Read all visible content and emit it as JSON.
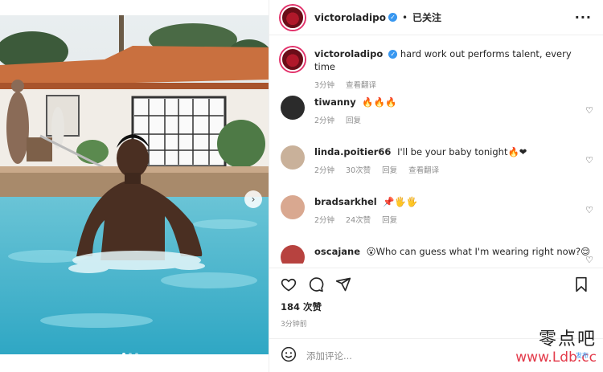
{
  "post": {
    "author": "victoroladipo",
    "follow_sep": "•",
    "follow_label": "已关注",
    "more_label": "···",
    "next_label": "›"
  },
  "caption": {
    "user": "victoroladipo",
    "text": "hard work out performs talent, every time",
    "time": "3分钟",
    "translate": "查看翻译"
  },
  "comments": [
    {
      "user": "tiwanny",
      "text": "🔥🔥🔥",
      "time": "2分钟",
      "likes": "",
      "reply": "回复",
      "translate": ""
    },
    {
      "user": "linda.poitier66",
      "text": "I'll be your baby tonight🔥❤",
      "time": "2分钟",
      "likes": "30次赞",
      "reply": "回复",
      "translate": "查看翻译"
    },
    {
      "user": "bradsarkhel",
      "text": "📌🖐🖐",
      "time": "2分钟",
      "likes": "24次赞",
      "reply": "回复",
      "translate": ""
    },
    {
      "user": "oscajane",
      "text": "😮Who can guess what I'm wearing right now?😌",
      "time": "",
      "likes": "",
      "reply": "",
      "translate": ""
    }
  ],
  "stats": {
    "likes": "184 次赞",
    "posted": "3分钟前"
  },
  "comment_input": {
    "placeholder": "添加评论..."
  },
  "watermark": {
    "cn": "零点吧",
    "en": "www.Ldb.cc",
    "tag": "发布"
  },
  "colors": {
    "verified": "#3897f0",
    "muted": "#8e8e8e",
    "watermark_red": "#e33a4a"
  }
}
